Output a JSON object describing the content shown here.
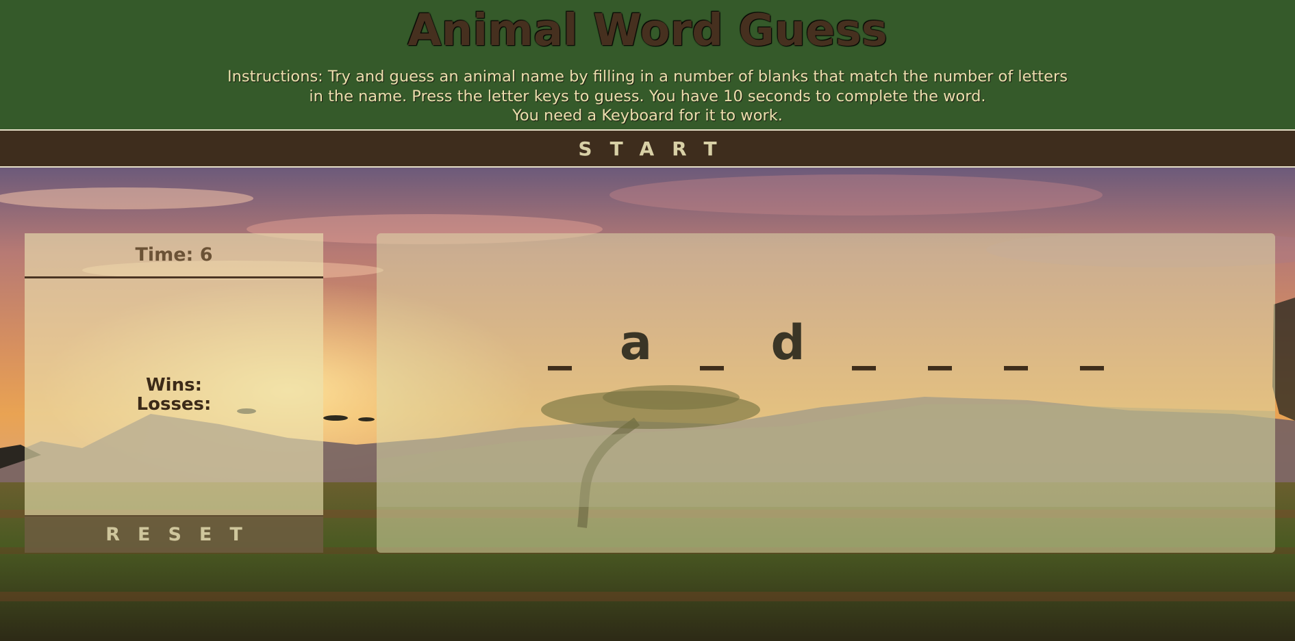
{
  "header": {
    "title": "Animal Word Guess",
    "instructions_line1": "Instructions: Try and guess an animal name by filling in a number of blanks that match the number of letters",
    "instructions_line2": "in the name. Press the letter keys to guess. You have 10 seconds to complete the word.",
    "instructions_line3": "You need a Keyboard for it to work."
  },
  "start_button": {
    "label": "START"
  },
  "left_panel": {
    "timer_label": "Time: 6",
    "wins_label": "Wins:",
    "losses_label": "Losses:",
    "reset_label": "RESET"
  },
  "word": {
    "slots": [
      "_",
      "a",
      "_",
      "d",
      "_",
      "_",
      "_",
      "_"
    ]
  },
  "colors": {
    "header_bg": "#355a2a",
    "bar_bg": "#3e2d1d",
    "title_color": "#46301f",
    "text_light": "#ecdfae"
  }
}
